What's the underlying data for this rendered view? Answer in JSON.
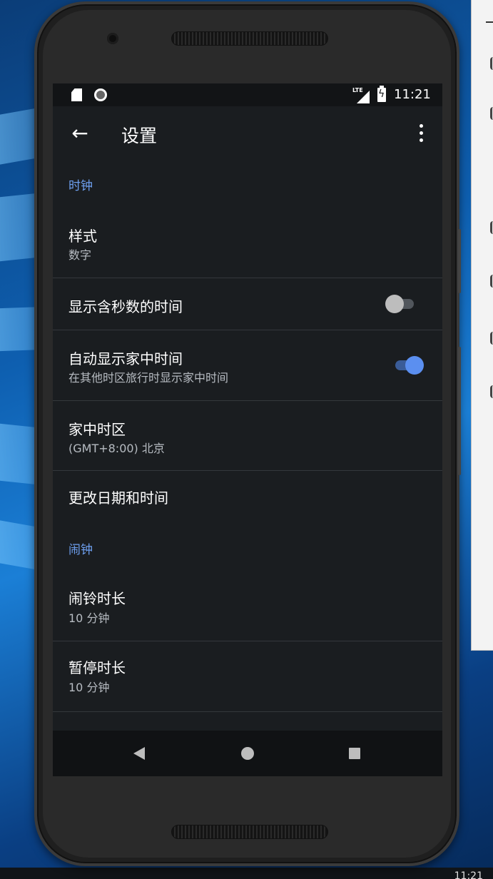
{
  "statusbar": {
    "time": "11:21",
    "icons": [
      "sd-card-icon",
      "sync-icon",
      "lte-signal-icon",
      "battery-charging-icon"
    ],
    "lte_label": "LTE"
  },
  "appbar": {
    "title": "设置",
    "back_icon": "arrow-left-icon",
    "menu_icon": "more-vert-icon"
  },
  "sections": {
    "clock_header": "时钟",
    "alarm_header": "闹钟"
  },
  "settings": {
    "style": {
      "title": "样式",
      "value": "数字"
    },
    "show_seconds": {
      "title": "显示含秒数的时间",
      "enabled": false
    },
    "auto_home_clock": {
      "title": "自动显示家中时间",
      "subtitle": "在其他时区旅行时显示家中时间",
      "enabled": true
    },
    "home_timezone": {
      "title": "家中时区",
      "value": "(GMT+8:00) 北京"
    },
    "change_datetime": {
      "title": "更改日期和时间"
    },
    "alarm_duration": {
      "title": "闹铃时长",
      "value": "10 分钟"
    },
    "snooze_duration": {
      "title": "暂停时长",
      "value": "10 分钟"
    }
  },
  "navbar": {
    "buttons": [
      "nav-back-icon",
      "nav-home-icon",
      "nav-recents-icon"
    ]
  },
  "colors": {
    "accent": "#6ea0f0",
    "background": "#1a1d20",
    "toggle_on": "#5b8ff0"
  }
}
